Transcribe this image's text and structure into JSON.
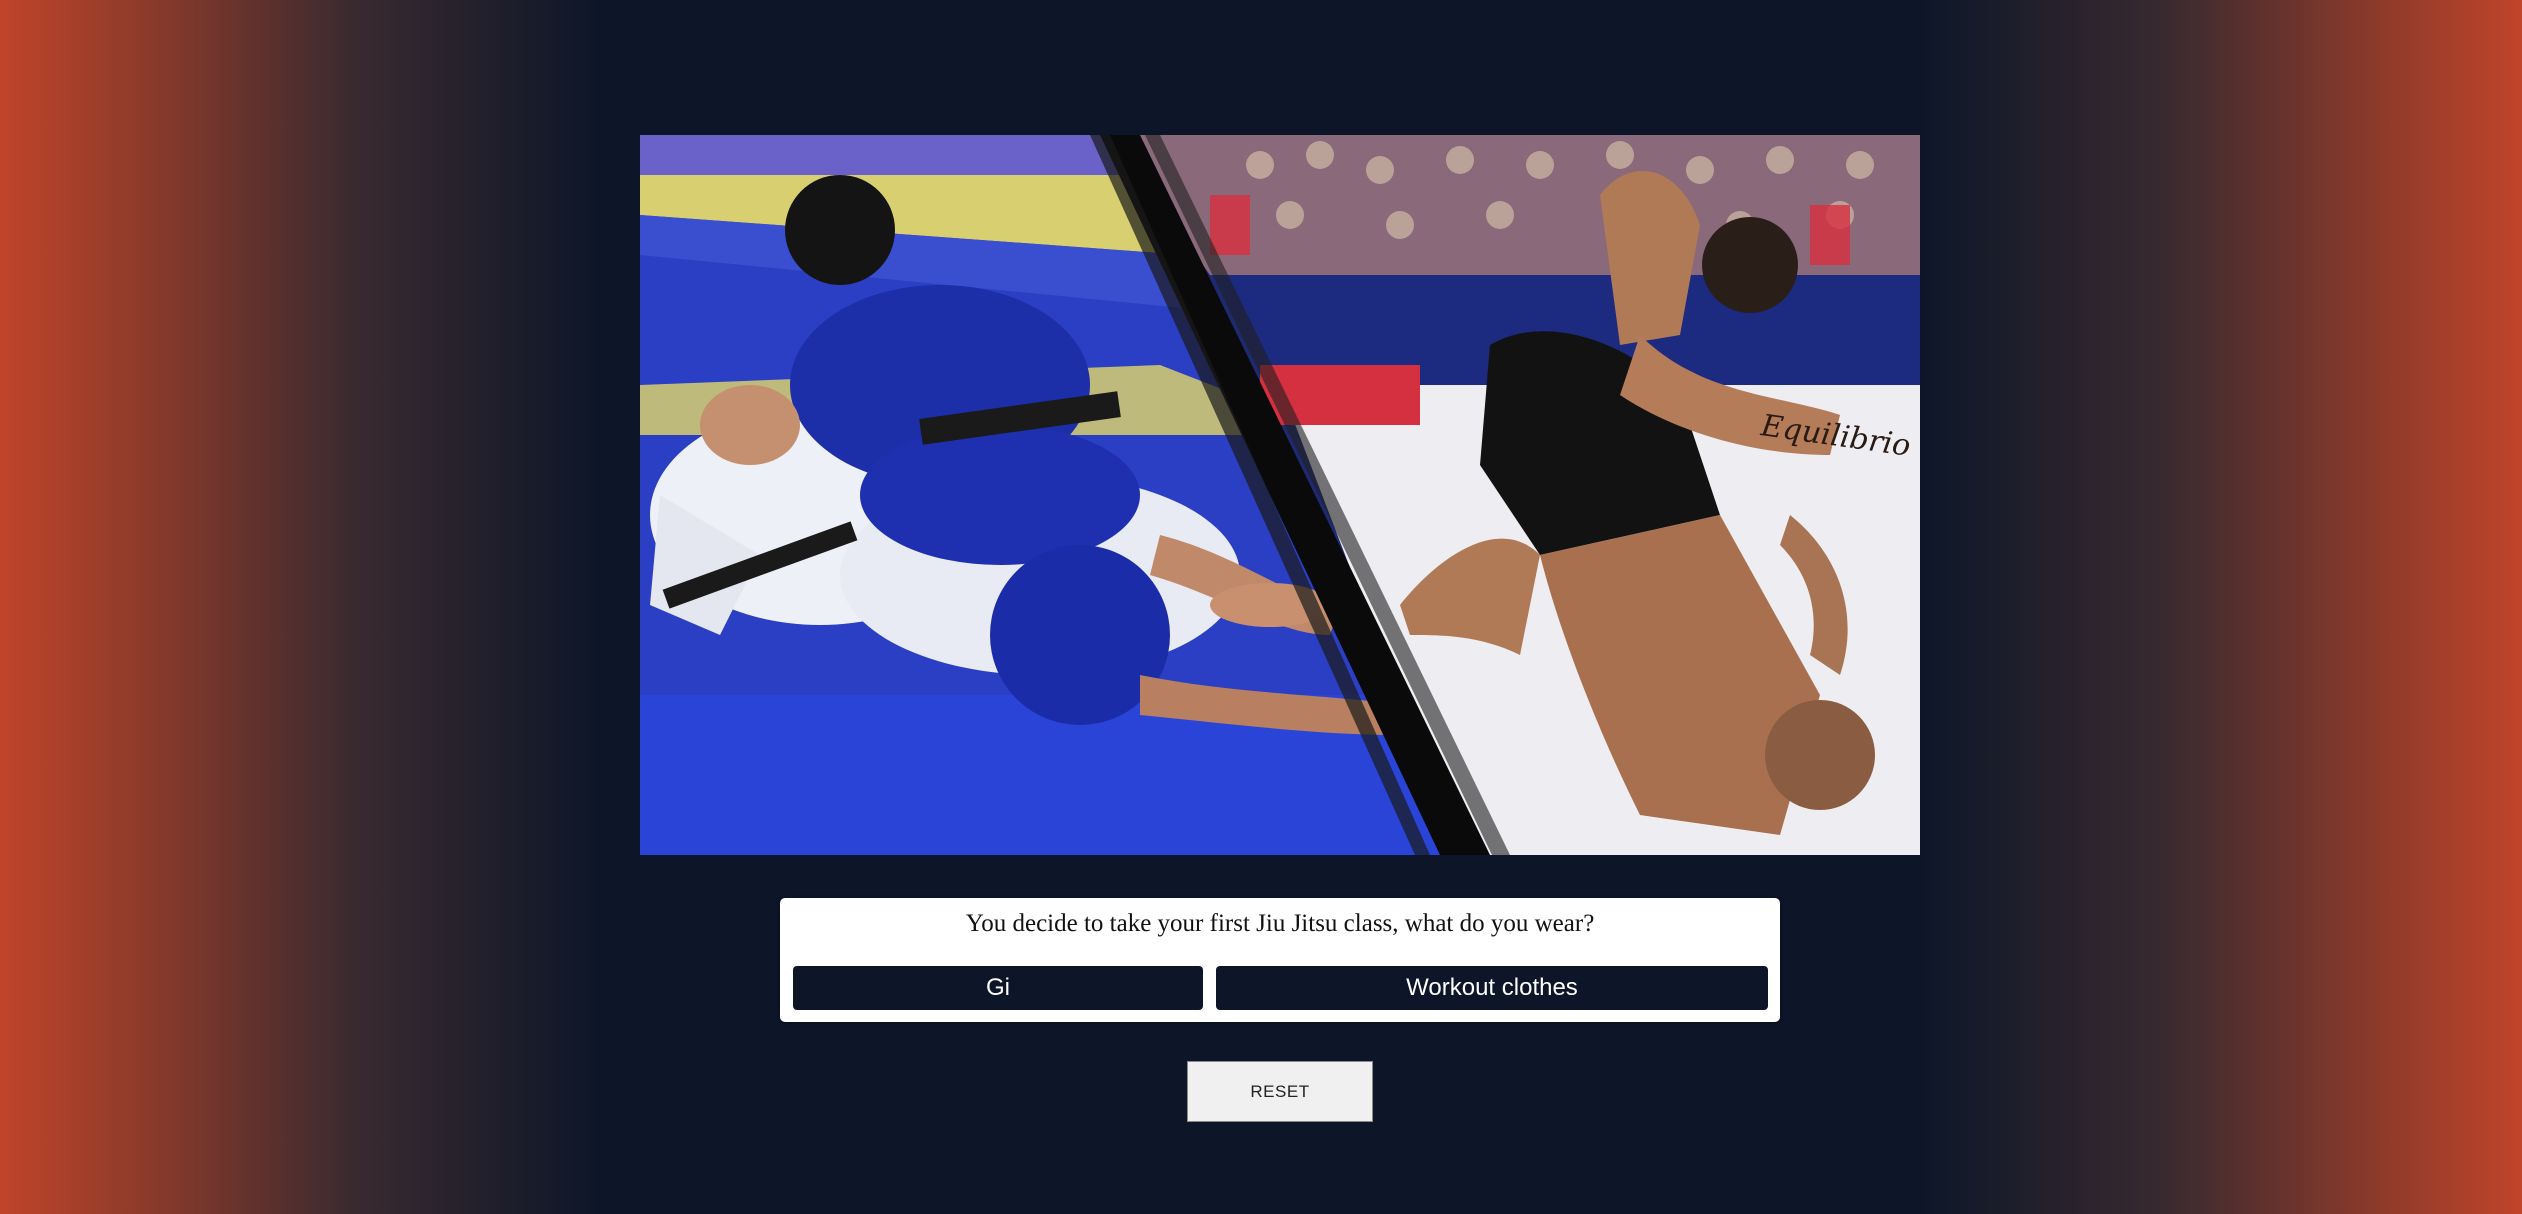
{
  "photo": {
    "icon": "bjj-gi-vs-nogi-photo",
    "tattoo_text": "Equilibrio"
  },
  "quiz": {
    "question": "You decide to take your first Jiu Jitsu class, what do you wear?",
    "choices": [
      "Gi",
      "Workout clothes"
    ]
  },
  "controls": {
    "reset_label": "RESET"
  },
  "colors": {
    "background_center": "#0c1628",
    "background_edge": "#c0442a",
    "button_fill": "#0c1628",
    "card_fill": "#ffffff"
  }
}
